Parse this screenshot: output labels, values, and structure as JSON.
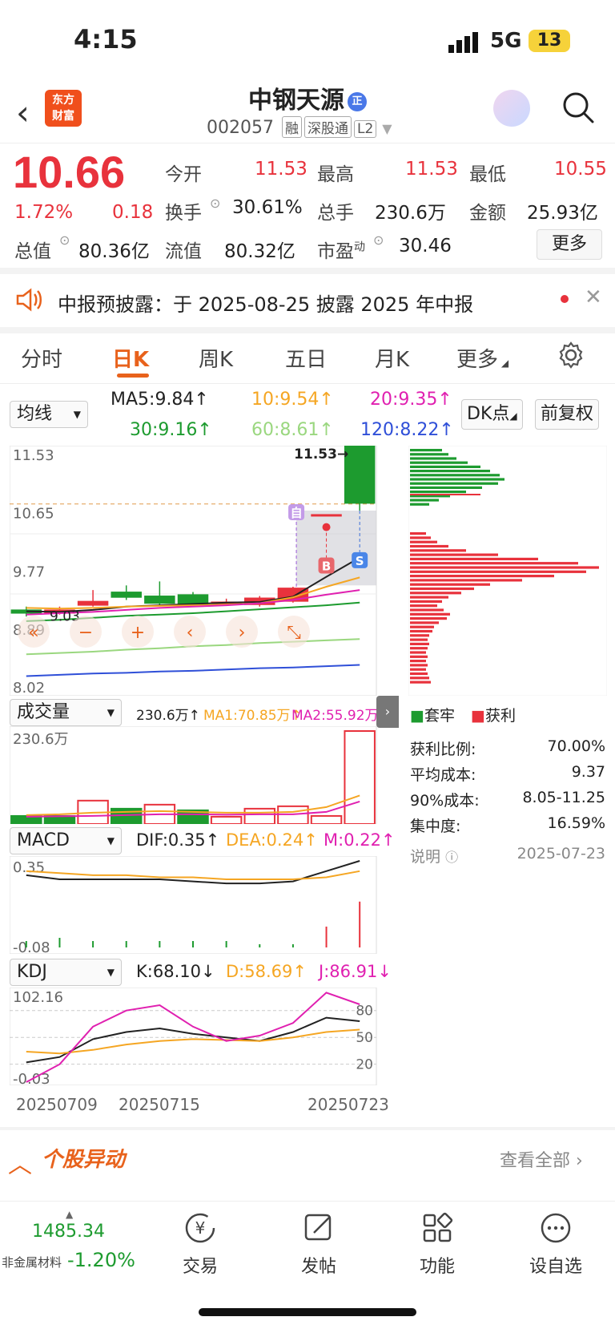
{
  "status": {
    "time": "4:15",
    "network": "5G",
    "battery": "13"
  },
  "header": {
    "stock_name": "中钢天源",
    "badge": "正",
    "code": "002057",
    "tags": [
      "融",
      "深股通",
      "L2"
    ],
    "logo_text": "东方财富"
  },
  "quote": {
    "price": "10.66",
    "pct": "1.72%",
    "change": "0.18",
    "fields": [
      {
        "label": "今开",
        "value": "11.53"
      },
      {
        "label": "最高",
        "value": "11.53"
      },
      {
        "label": "最低",
        "value": "10.55"
      },
      {
        "label": "换手",
        "value": "30.61%"
      },
      {
        "label": "总手",
        "value": "230.6万"
      },
      {
        "label": "金额",
        "value": "25.93亿"
      },
      {
        "label": "总值",
        "value": "80.36亿"
      },
      {
        "label": "流值",
        "value": "80.32亿"
      },
      {
        "label": "市盈",
        "sup": "动",
        "value": "30.46"
      }
    ],
    "more_label": "更多"
  },
  "notice": {
    "text": "中报预披露：于 2025-08-25 披露 2025 年中报"
  },
  "tabs": [
    "分时",
    "日K",
    "周K",
    "五日",
    "月K",
    "更多"
  ],
  "ma_panel": {
    "selector": "均线",
    "ma5": "MA5:9.84↑",
    "ma10": "10:9.54↑",
    "ma20": "20:9.35↑",
    "ma30": "30:9.16↑",
    "ma60": "60:8.61↑",
    "ma120": "120:8.22↑",
    "dk_label": "DK点",
    "fq_label": "前复权",
    "ma_colors": {
      "ma5": "#222222",
      "ma10": "#f5a623",
      "ma20": "#e020b0",
      "ma30": "#1d9b2f",
      "ma60": "#9ad77f",
      "ma120": "#2f4fd8"
    }
  },
  "chart_data": [
    {
      "type": "candlestick",
      "title": "",
      "ylabels": [
        "11.53",
        "10.65",
        "9.77",
        "8.89",
        "8.02"
      ],
      "high_marker": "11.53→",
      "low_marker": "9.03",
      "markers": [
        "自",
        "B",
        "S"
      ],
      "candles": [
        {
          "open": 9.05,
          "close": 9.0,
          "high": 9.1,
          "low": 8.95
        },
        {
          "open": 9.0,
          "close": 9.05,
          "high": 9.1,
          "low": 8.98
        },
        {
          "open": 9.12,
          "close": 9.18,
          "high": 9.35,
          "low": 9.1
        },
        {
          "open": 9.32,
          "close": 9.24,
          "high": 9.42,
          "low": 9.2
        },
        {
          "open": 9.26,
          "close": 9.15,
          "high": 9.48,
          "low": 9.12
        },
        {
          "open": 9.28,
          "close": 9.13,
          "high": 9.32,
          "low": 9.1
        },
        {
          "open": 9.17,
          "close": 9.17,
          "high": 9.22,
          "low": 9.12
        },
        {
          "open": 9.13,
          "close": 9.23,
          "high": 9.26,
          "low": 9.1
        },
        {
          "open": 9.18,
          "close": 9.38,
          "high": 9.4,
          "low": 9.16
        },
        {
          "open": 10.49,
          "close": 10.49,
          "high": 10.49,
          "low": 10.49
        },
        {
          "open": 11.53,
          "close": 10.66,
          "high": 11.53,
          "low": 10.55
        }
      ]
    },
    {
      "type": "bar",
      "title": "成交量",
      "value_label": "230.6万↑",
      "ma1": "MA1:70.85万↑",
      "ma2": "MA2:55.92万↑",
      "ylabel_top": "230.6万",
      "values": [
        20,
        20,
        58,
        38,
        48,
        34,
        18,
        38,
        44,
        20,
        230.6
      ],
      "up": [
        false,
        false,
        true,
        false,
        true,
        false,
        true,
        true,
        true,
        true,
        true
      ]
    },
    {
      "type": "line",
      "title": "MACD",
      "dif": "DIF:0.35↑",
      "dea": "DEA:0.24↑",
      "m": "M:0.22↑",
      "ylabels": [
        "0.35",
        "-0.08"
      ]
    },
    {
      "type": "line",
      "title": "KDJ",
      "k": "K:68.10↓",
      "d": "D:58.69↑",
      "j": "J:86.91↓",
      "ylabels": [
        "102.16",
        "-0.03"
      ],
      "right_labels": [
        "80",
        "50",
        "20"
      ],
      "x": [
        "20250709",
        "20250715",
        "20250723"
      ]
    }
  ],
  "chip_panel": {
    "legend_trap": "套牢",
    "legend_profit": "获利",
    "rows": [
      {
        "label": "获利比例:",
        "value": "70.00%"
      },
      {
        "label": "平均成本:",
        "value": "9.37"
      },
      {
        "label": "90%成本:",
        "value": "8.05-11.25"
      },
      {
        "label": "集中度:",
        "value": "16.59%"
      }
    ],
    "note": "说明",
    "date": "2025-07-23"
  },
  "alert": {
    "title": "个股异动",
    "link": "查看全部"
  },
  "bottom": {
    "index_value": "1485.34",
    "index_name": "非金属材料",
    "index_pct": "-1.20%",
    "nav": [
      "交易",
      "发帖",
      "功能",
      "设自选"
    ]
  }
}
